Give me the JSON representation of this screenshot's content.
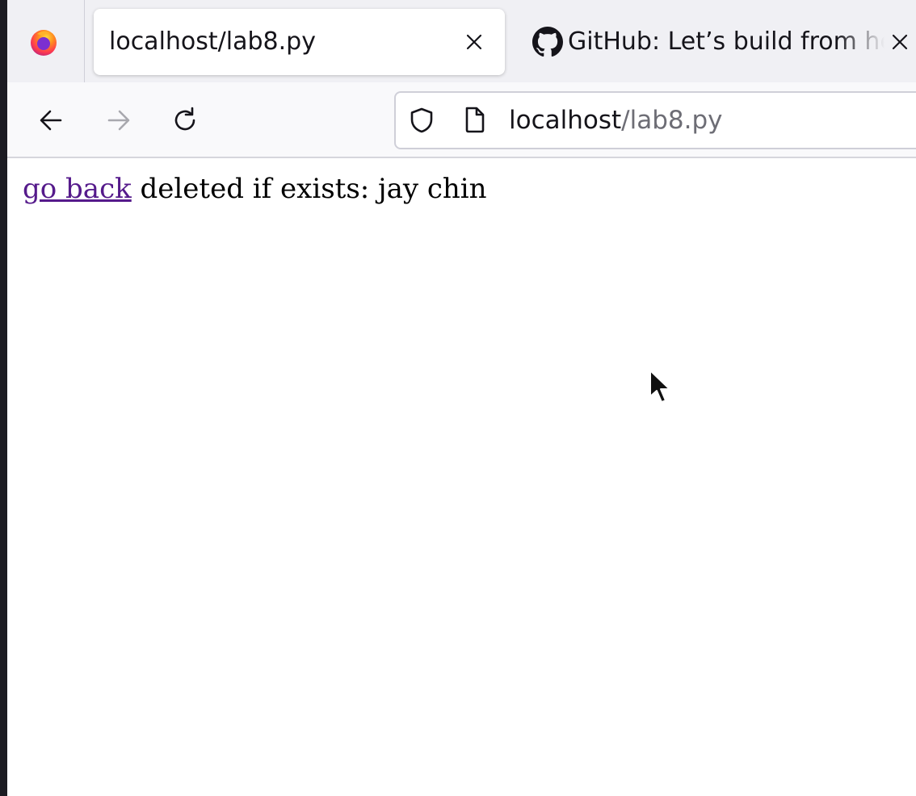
{
  "browser": {
    "tabs": [
      {
        "title": "localhost/lab8.py",
        "active": true,
        "icon": "none",
        "close_icon": "close-icon"
      },
      {
        "title": "GitHub: Let’s build from here",
        "active": false,
        "icon": "github-icon",
        "close_icon": "close-icon"
      }
    ],
    "app_icon": "firefox-icon",
    "toolbar": {
      "back_icon": "arrow-left-icon",
      "forward_icon": "arrow-right-icon",
      "reload_icon": "reload-icon"
    },
    "urlbar": {
      "security_icon": "shield-icon",
      "page_icon": "page-icon",
      "host": "localhost",
      "path": "/lab8.py"
    }
  },
  "page": {
    "link_text": "go back",
    "message": "deleted if exists: jay chin"
  },
  "colors": {
    "link_visited": "#551a8b",
    "tabstrip_bg": "#f0f0f4",
    "toolbar_bg": "#f9f9fb"
  }
}
